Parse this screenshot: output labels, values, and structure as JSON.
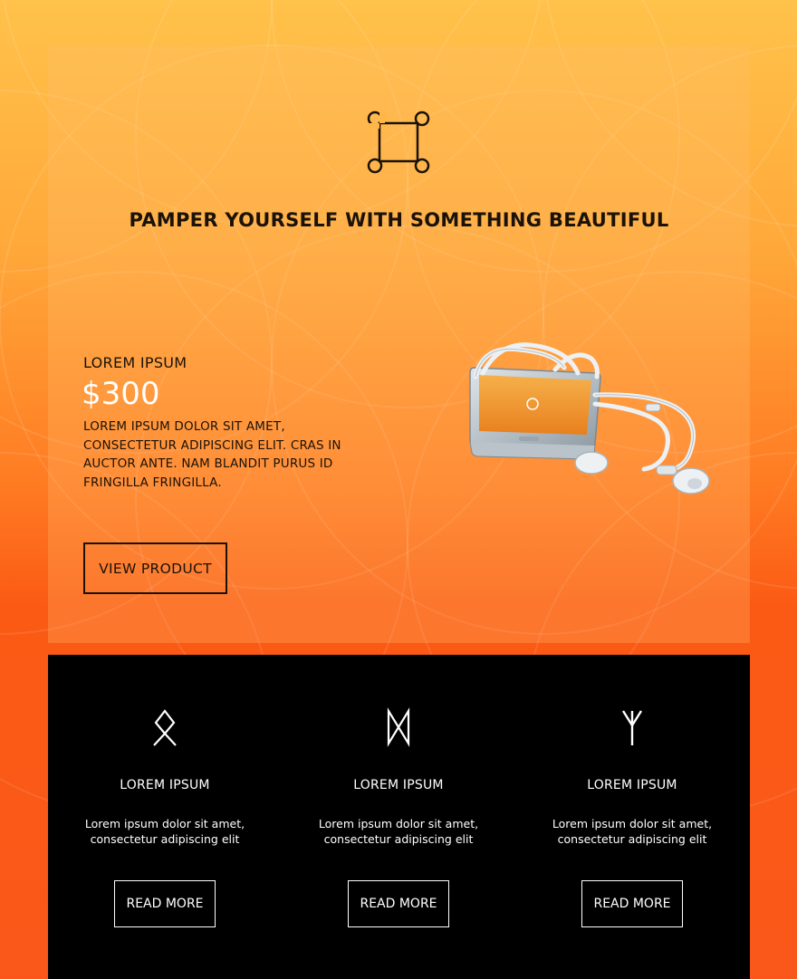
{
  "hero": {
    "logo_icon": "command-key-icon",
    "title": "PAMPER YOURSELF WITH SOMETHING BEAUTIFUL",
    "product": {
      "name": "LOREM IPSUM",
      "price": "$300",
      "description": "LOREM IPSUM DOLOR SIT AMET, CONSECTETUR ADIPISCING ELIT. CRAS IN AUCTOR ANTE. NAM BLANDIT PURUS ID FRINGILLA FRINGILLA.",
      "button_label": "VIEW PRODUCT",
      "image": "smartphone-with-earphones"
    }
  },
  "features": [
    {
      "icon": "othala-rune-icon",
      "title": "LOREM IPSUM",
      "text": "Lorem ipsum dolor sit amet, consectetur adipiscing elit",
      "button_label": "READ MORE"
    },
    {
      "icon": "dagaz-rune-icon",
      "title": "LOREM IPSUM",
      "text": "Lorem ipsum dolor sit amet, consectetur adipiscing elit",
      "button_label": "READ MORE"
    },
    {
      "icon": "algiz-rune-icon",
      "title": "LOREM IPSUM",
      "text": "Lorem ipsum dolor sit amet, consectetur adipiscing elit",
      "button_label": "READ MORE"
    }
  ],
  "colors": {
    "background_top": "#ffc24a",
    "background_bottom": "#f9581a",
    "features_background": "#000000",
    "text_dark": "#1a1208",
    "text_light": "#ffffff"
  }
}
